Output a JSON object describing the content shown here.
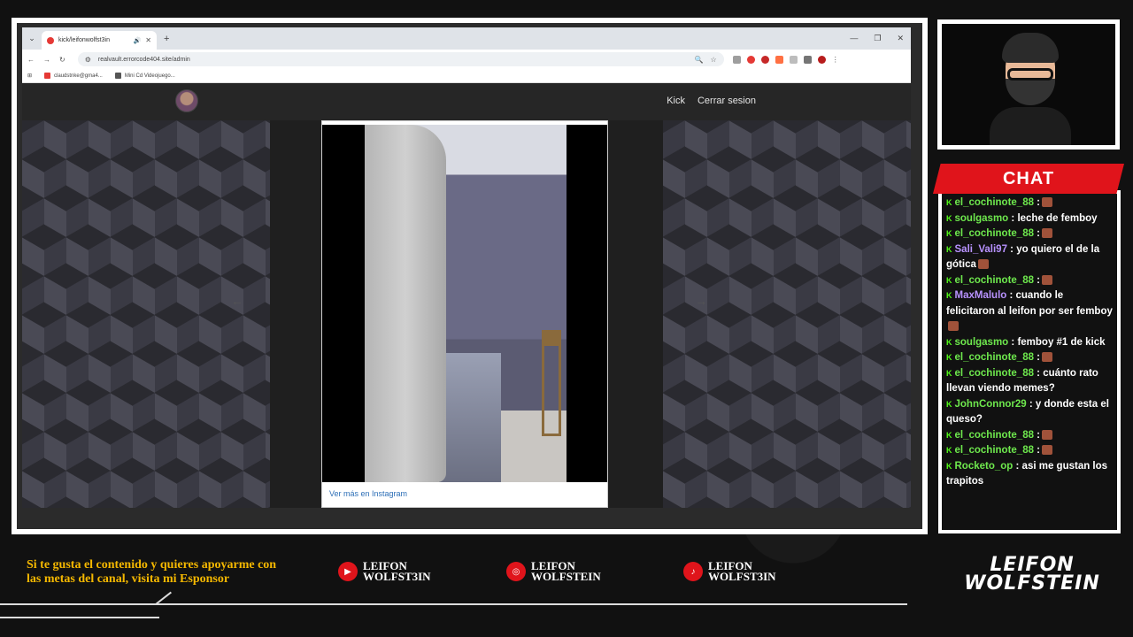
{
  "browser": {
    "tab_title": "kick/leifonwolfst3in",
    "url": "realvault.errorcode404.site/admin",
    "bookmarks": [
      "claudstnke@gma4...",
      "Mini Cd Videojuego..."
    ]
  },
  "site": {
    "nav": [
      "Kick",
      "Cerrar sesion"
    ],
    "instagram_link": "Ver más en Instagram"
  },
  "chat": {
    "title": "CHAT",
    "messages": [
      {
        "user": "el_cochinote_88",
        "text": ":",
        "emote": true,
        "color": "green"
      },
      {
        "user": "soulgasmo",
        "text": ": leche de femboy",
        "color": "green"
      },
      {
        "user": "el_cochinote_88",
        "text": ":",
        "emote": true,
        "color": "green"
      },
      {
        "user": "Sali_Vali97",
        "text": ": yo quiero el de la gótica",
        "emote": true,
        "color": "purple"
      },
      {
        "user": "el_cochinote_88",
        "text": ":",
        "emote": true,
        "color": "green"
      },
      {
        "user": "MaxMalulo",
        "text": ": cuando le felicitaron al leifon por ser femboy",
        "emote": true,
        "color": "purple"
      },
      {
        "user": "soulgasmo",
        "text": ": femboy #1 de kick",
        "color": "green"
      },
      {
        "user": "el_cochinote_88",
        "text": ":",
        "emote": true,
        "color": "green"
      },
      {
        "user": "el_cochinote_88",
        "text": ": cuánto rato llevan viendo memes?",
        "color": "green"
      },
      {
        "user": "JohnConnor29",
        "text": ": y donde esta el queso?",
        "color": "green"
      },
      {
        "user": "el_cochinote_88",
        "text": ":",
        "emote": true,
        "color": "green"
      },
      {
        "user": "el_cochinote_88",
        "text": ":",
        "emote": true,
        "color": "green"
      },
      {
        "user": "Rocketo_op",
        "text": ": asi me gustan los trapitos",
        "color": "green"
      }
    ]
  },
  "footer": {
    "support_text": "Si te gusta el contenido y quieres apoyarme con las metas del canal, visita mi Esponsor",
    "socials": [
      {
        "icon": "youtube-icon",
        "line1": "LEIFON",
        "line2": "WOLFST3IN"
      },
      {
        "icon": "instagram-icon",
        "line1": "LEIFON",
        "line2": "WOLFSTEIN"
      },
      {
        "icon": "tiktok-icon",
        "line1": "LEIFON",
        "line2": "WOLFST3IN"
      }
    ],
    "brand_line1": "LEIFON",
    "brand_line2": "WOLFSTEIN"
  },
  "colors": {
    "accent": "#e0141b",
    "gold": "#f5b800",
    "kick_green": "#53fc18"
  }
}
